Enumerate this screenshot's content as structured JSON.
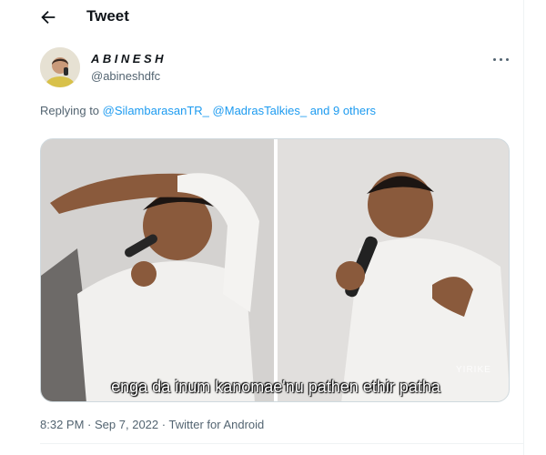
{
  "header": {
    "title": "Tweet",
    "back_icon": "arrow-left-icon"
  },
  "tweet": {
    "display_name": "ABINESH",
    "handle": "@abineshdfc",
    "more_icon": "more-horizontal-icon",
    "reply_prefix": "Replying to",
    "mentions": [
      "@SilambarasanTR_",
      "@MadrasTalkies_"
    ],
    "and_others": "and 9 others",
    "media_caption": "enga da inum kanomae'nu pathen ethir patha",
    "media_watermark": "YIRIKE",
    "time": "8:32 PM",
    "date": "Sep 7, 2022",
    "source": "Twitter for Android",
    "separator": "·"
  },
  "colors": {
    "link": "#1d9bf0",
    "muted": "#536471",
    "text": "#0f1419",
    "border": "#cfd9de"
  }
}
